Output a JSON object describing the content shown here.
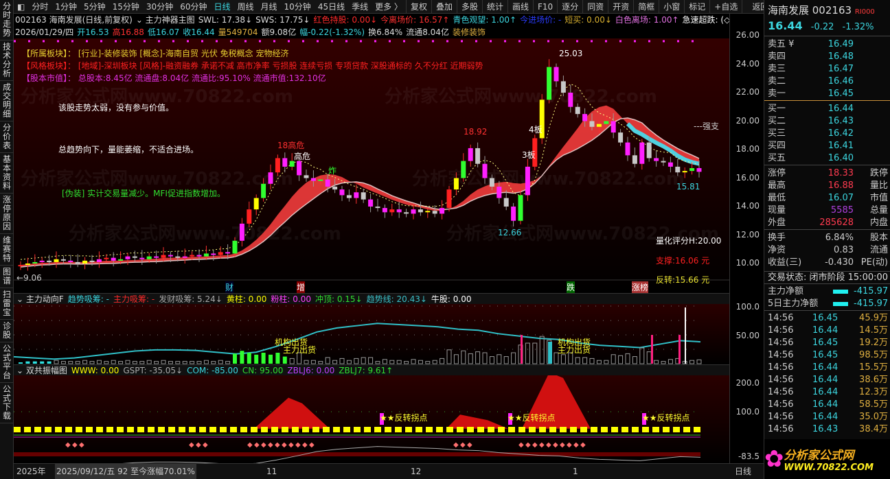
{
  "left_tabs": [
    "分时走势",
    "技术分析",
    "成交明细",
    "分价表",
    "基本资料",
    "涨停原因",
    "维赛特",
    "图谱",
    "扫雷宝",
    "诊股",
    "公式平台",
    "公式下载"
  ],
  "toolbar": {
    "periods": [
      "分时",
      "1分钟",
      "5分钟",
      "15分钟",
      "30分钟",
      "60分钟",
      "日线",
      "周线",
      "月线",
      "10分钟",
      "45日线",
      "季线",
      "更多 〉"
    ],
    "active": "日线",
    "actions": [
      "复权",
      "叠加",
      "多股",
      "统计",
      "画线",
      "F10",
      "逐分",
      "同资",
      "开资",
      "简框",
      "小窗",
      "标记",
      "+自选"
    ],
    "back": "返回"
  },
  "info_line1": [
    {
      "t": "002163 海南发展(日线,前复权)",
      "c": "#ddd"
    },
    {
      "t": "⌄ 主力神器主图",
      "c": "#ddd"
    },
    {
      "t": "SWL: 17.38↓",
      "c": "#ddd"
    },
    {
      "t": "SWS: 17.75↓",
      "c": "#ddd"
    },
    {
      "t": "红色持股: 0.00↓",
      "c": "#ff2a2a"
    },
    {
      "t": "今离场价: 16.57↑",
      "c": "#ff3030"
    },
    {
      "t": "青色观望: 1.00↑",
      "c": "#3cd6e0"
    },
    {
      "t": "今进场价: -",
      "c": "#2b3cff"
    },
    {
      "t": "短买: 0.00↓",
      "c": "#d8b030"
    },
    {
      "t": "白色离场: 1.00↑",
      "c": "#e070e0"
    },
    {
      "t": "急速超跌: (◇",
      "c": "#fff"
    }
  ],
  "info_line2": [
    {
      "t": "2026/01/29/四",
      "c": "#ddd"
    },
    {
      "t": "开16.53",
      "c": "#3cd6e0"
    },
    {
      "t": "高16.88",
      "c": "#ff3030"
    },
    {
      "t": "低16.07",
      "c": "#3cd6e0"
    },
    {
      "t": "收16.44",
      "c": "#3cd6e0"
    },
    {
      "t": "量549704",
      "c": "#e0b040"
    },
    {
      "t": "额9.08亿",
      "c": "#ddd"
    },
    {
      "t": "幅-0.22(-1.32%)",
      "c": "#3cd6e0"
    },
    {
      "t": "换6.84%",
      "c": "#ddd"
    },
    {
      "t": "流通8.04亿",
      "c": "#ddd"
    },
    {
      "t": "装修装饰",
      "c": "#e0b040"
    }
  ],
  "sector": {
    "l1": "【所属板块】：  [行业]-装修装饰 [概念]-海南自贸 光伏 免税概念 宠物经济",
    "l2": "【风格板块】：  [地域]-深圳板块 [风格]-融资融券 承诺不减 高市净率 亏损股 连续亏损 专项贷款 深股通标的 久不分红 近期弱势",
    "l3": "【股本市值】：  总股本:8.45亿 流通盘:8.04亿 流通比:95.10% 流通市值:132.10亿"
  },
  "comments": [
    "该股走势太弱，没有参与价值。",
    "总趋势向下，量能萎缩，不适合进场。",
    "[伪装]  实计交易量减少。MFI促进指数增加。"
  ],
  "chart_labels": {
    "high_risk": "18高危",
    "risk": "高危",
    "zha": "炸",
    "p1892": "18.92",
    "p2503": "25.03",
    "b4": "4板",
    "b3": "3板",
    "p1266": "12.66",
    "p1581": "15.81",
    "strong": "---强支",
    "score": "量化评分H:20.00",
    "support": "支撑:16.06 元",
    "reversal": "反转:15.66 元",
    "left_low": "←9.06",
    "m_cai": "财",
    "m_zeng": "增",
    "m_die": "跌",
    "m_bang": "涨榜"
  },
  "price_axis": [
    "26.00",
    "24.00",
    "22.00",
    "20.00",
    "18.00",
    "16.00",
    "14.00",
    "12.00",
    "10.00"
  ],
  "closes": [
    9.9,
    10.0,
    10.1,
    10.2,
    10.1,
    10.3,
    10.2,
    10.1,
    10.0,
    10.2,
    10.1,
    10.3,
    10.4,
    10.2,
    10.3,
    10.5,
    10.4,
    10.3,
    10.5,
    10.4,
    10.6,
    10.5,
    10.4,
    10.5,
    10.6,
    10.5,
    10.7,
    10.6,
    10.8,
    10.7,
    11.6,
    12.8,
    13.8,
    14.6,
    15.6,
    16.4,
    17.4,
    16.8,
    17.2,
    16.2,
    16.0,
    15.8,
    15.9,
    15.4,
    15.2,
    14.8,
    14.6,
    15.0,
    14.5,
    14.0,
    13.9,
    13.6,
    13.8,
    13.6,
    13.5,
    13.8,
    13.6,
    13.7,
    13.5,
    13.9,
    15.2,
    16.0,
    17.2,
    18.1,
    17.0,
    16.0,
    15.4,
    14.6,
    14.0,
    13.0,
    14.8,
    16.8,
    18.8,
    21.5,
    23.8,
    22.8,
    22.0,
    21.0,
    20.5,
    20.0,
    19.6,
    19.8,
    20.0,
    19.2,
    18.5,
    17.6,
    17.0,
    18.5,
    17.4,
    17.2,
    17.1,
    16.8,
    16.4,
    16.5,
    16.7,
    16.44
  ],
  "ind1": {
    "head": [
      {
        "t": "⌄ 主力动向F",
        "c": "#ddd"
      },
      {
        "t": "趋势吸筹: -",
        "c": "#3cd6e0"
      },
      {
        "t": "主力吸筹: -",
        "c": "#ff2a2a"
      },
      {
        "t": "发财吸筹: 5.24↓",
        "c": "#aaa"
      },
      {
        "t": "黄柱: 0.00",
        "c": "#ffff00"
      },
      {
        "t": "粉柱: 0.00",
        "c": "#ff40ff"
      },
      {
        "t": "冲顶: 0.15↓",
        "c": "#30e030"
      },
      {
        "t": "趋势线: 20.43↓",
        "c": "#3cc0c8"
      },
      {
        "t": "牛股: 0.00",
        "c": "#fff"
      }
    ],
    "axis": [
      "100.0",
      "50.00"
    ],
    "trend": [
      12,
      10,
      8,
      10,
      14,
      18,
      22,
      24,
      24,
      23,
      20,
      17,
      20,
      30,
      42,
      55,
      62,
      66,
      70,
      68,
      66,
      64,
      60,
      58,
      52,
      48,
      44,
      42,
      36,
      32,
      30,
      28,
      34,
      40,
      38
    ],
    "label_out1": "机构出货",
    "label_out2": "主力出货"
  },
  "ind2": {
    "head": [
      {
        "t": "⌄ 双共振幅图",
        "c": "#ddd"
      },
      {
        "t": "WWW: 0.00",
        "c": "#ffff00"
      },
      {
        "t": "GSPT: -35.05↓",
        "c": "#aaa"
      },
      {
        "t": "COM: -85.00",
        "c": "#3cd6e0"
      },
      {
        "t": "CN: 95.00",
        "c": "#30e030"
      },
      {
        "t": "ZBLJ6: 0.00",
        "c": "#c040ff"
      },
      {
        "t": "ZBLJ7: 9.61↑",
        "c": "#30e030"
      }
    ],
    "axis": [
      "200.0",
      "100.0",
      "-83.5"
    ],
    "reversal_label": "★★反转拐点"
  },
  "time_axis": {
    "year": "2025年",
    "cursor": "2025/09/12/五 92 至今涨幅70.01%",
    "months": [
      "11",
      "12",
      "1"
    ],
    "period": "日线"
  },
  "quote": {
    "name": "海南发展 002163",
    "badge": "RI000",
    "price": "16.44",
    "change": "-0.22",
    "pct": "-1.32%",
    "asks": [
      [
        "卖五 ¥",
        "16.49"
      ],
      [
        "卖四",
        "16.48"
      ],
      [
        "卖三",
        "16.47"
      ],
      [
        "卖二",
        "16.46"
      ],
      [
        "卖一",
        "16.45"
      ]
    ],
    "bids": [
      [
        "买一",
        "16.44"
      ],
      [
        "买二",
        "16.43"
      ],
      [
        "买三",
        "16.42"
      ],
      [
        "买四",
        "16.41"
      ],
      [
        "买五",
        "16.40"
      ]
    ],
    "stats": [
      [
        "涨停",
        "18.33",
        "#ff3b50",
        "跌停"
      ],
      [
        "最高",
        "16.88",
        "#ff3b50",
        "量比"
      ],
      [
        "最低",
        "16.07",
        "#3cd6e0",
        "市值"
      ],
      [
        "现量",
        "5585",
        "#b040e0",
        "总量"
      ],
      [
        "外盘",
        "285628",
        "#ff3b50",
        "内盘"
      ]
    ],
    "stats2": [
      [
        "换手",
        "6.84%",
        "股本"
      ],
      [
        "净资",
        "0.83",
        "流通"
      ],
      [
        "收益(三)",
        "-0.430",
        "PE(动)"
      ]
    ],
    "status": "交易状态: 闭市阶段 15:00:00",
    "flow": [
      [
        "主力净额",
        "-415.97"
      ],
      [
        "5日主力净额",
        "-415.97"
      ]
    ],
    "ticks": [
      [
        "14:56",
        "16.45",
        "45.9万"
      ],
      [
        "14:56",
        "16.44",
        "14.5万"
      ],
      [
        "14:56",
        "16.45",
        "19.2万"
      ],
      [
        "14:56",
        "16.45",
        "98.5万"
      ],
      [
        "14:56",
        "16.44",
        "15.5万"
      ],
      [
        "14:56",
        "16.44",
        "38.6万"
      ],
      [
        "14:56",
        "16.44",
        "12.3万"
      ],
      [
        "14:56",
        "16.44",
        "58.5万"
      ],
      [
        "14:56",
        "16.44",
        "35.0万"
      ],
      [
        "14:56",
        "16.43",
        "38.4万"
      ]
    ]
  },
  "logo": {
    "cn": "分析家公式网",
    "url": "WWW.70822.COM"
  },
  "watermark": "分析家公式网www.70822.com"
}
